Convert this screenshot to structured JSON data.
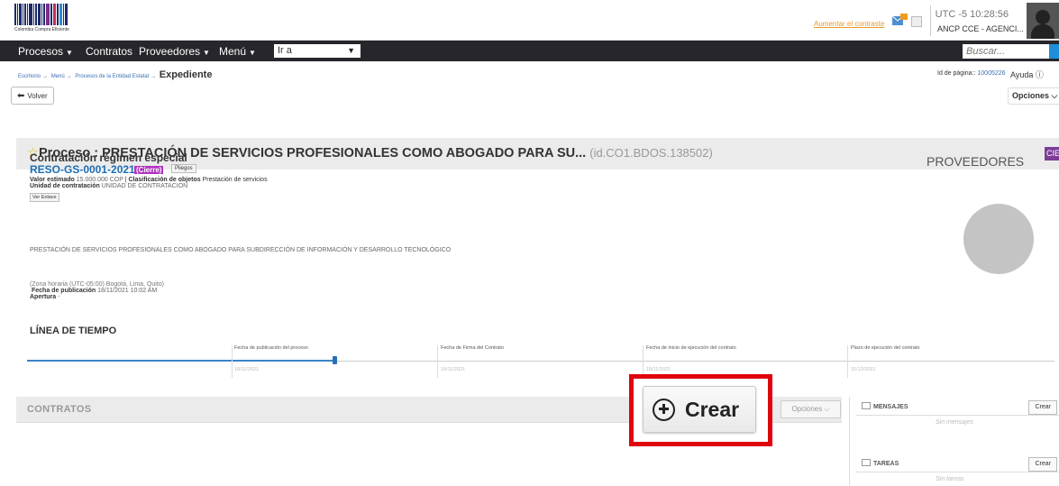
{
  "header": {
    "logo_caption": "Colombia Compra Eficiente",
    "aumentar_link": "Aumentar el contraste",
    "clock": "UTC -5 10:28:56",
    "user": "ANCP CCE - AGENCI..."
  },
  "nav": {
    "items": [
      "Procesos",
      "Contratos",
      "Proveedores",
      "Menú"
    ],
    "ira": "Ir a",
    "search_placeholder": "Buscar..."
  },
  "breadcrumb": {
    "items": [
      "Escritorio",
      "Menú",
      "Procesos de la Entidad Estatal"
    ],
    "current": "Expediente"
  },
  "page_id": {
    "label": "Id de página::",
    "value": "10005226"
  },
  "help_label": "Ayuda",
  "volver_label": "Volver",
  "opciones_label": "Opciones",
  "process": {
    "title": "Proceso : PRESTACIÓN DE SERVICIOS PROFESIONALES COMO ABOGADO PARA SU...",
    "id": "(id.CO1.BDOS.138502)",
    "badge": "CIERRE",
    "regime": "Contratación régimen especial",
    "code": "RESO-GS-0001-2021",
    "code_status": "(Cierre)",
    "pliegos": "Pliegos",
    "valor_label": "Valor estimado",
    "valor": "15.000.000 COP",
    "clasificacion_label": "Clasificación de objetos",
    "clasificacion": "Prestación de servicios",
    "unidad_label": "Unidad de contratación",
    "unidad": "UNIDAD DE CONTRATACIÓN",
    "ver_enlace": "Ver Enlace",
    "description": "PRESTACIÓN DE SERVICIOS PROFESIONALES COMO ABOGADO PARA SUBDIRECCIÓN DE INFORMACIÓN Y DESARROLLO TECNOLÓGICO",
    "zona": "(Zona horaria (UTC-05:00) Bogotá, Lima, Quito)",
    "fecha_pub_label": "Fecha de publicación",
    "fecha_pub": "18/11/2021 10:02 AM",
    "apertura_label": "Apertura",
    "apertura": "-"
  },
  "proveedores_title": "PROVEEDORES",
  "timeline": {
    "title": "LÍNEA DE TIEMPO",
    "steps": [
      {
        "label": "Fecha de publicación del proceso",
        "date": "18/11/2021"
      },
      {
        "label": "Fecha de Firma del Contrato",
        "date": "18/11/2021"
      },
      {
        "label": "Fecha de inicio de ejecución del contrato",
        "date": "18/11/2021"
      },
      {
        "label": "Plazo de ejecución del contrato",
        "date": "31/12/2021"
      }
    ]
  },
  "contratos": {
    "title": "CONTRATOS",
    "crear_label": "Crear",
    "opciones_label": "Opciones"
  },
  "mensajes": {
    "title": "MENSAJES",
    "crear": "Crear",
    "empty": "Sin mensajes"
  },
  "tareas": {
    "title": "TAREAS",
    "crear": "Crear",
    "empty": "Sin tareas"
  },
  "colors": {
    "nav_bg": "#26262c",
    "link_blue": "#1c6db5",
    "badge_purple": "#7d3d96",
    "highlight_red": "#e0040c",
    "timeline_blue": "#3b84c8"
  }
}
